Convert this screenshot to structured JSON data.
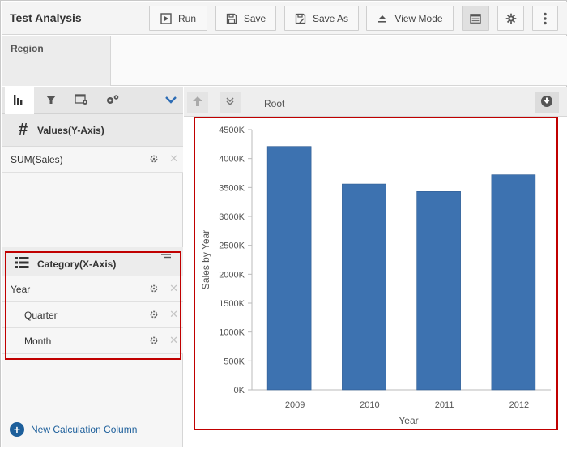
{
  "header": {
    "title": "Test Analysis",
    "buttons": [
      {
        "label": "Run",
        "icon": "play-icon"
      },
      {
        "label": "Save",
        "icon": "floppy-icon"
      },
      {
        "label": "Save As",
        "icon": "floppy-pencil-icon"
      },
      {
        "label": "View Mode",
        "icon": "eject-icon"
      }
    ]
  },
  "region": {
    "label": "Region"
  },
  "left_panel": {
    "values_title": "Values(Y-Axis)",
    "values_fields": [
      "SUM(Sales)"
    ],
    "category_title": "Category(X-Axis)",
    "category_fields": [
      "Year",
      "Quarter",
      "Month"
    ],
    "new_calc_label": "New Calculation Column"
  },
  "nav": {
    "root_label": "Root"
  },
  "chart_data": {
    "type": "bar",
    "categories": [
      "2009",
      "2010",
      "2011",
      "2012"
    ],
    "values": [
      4210000,
      3560000,
      3430000,
      3720000
    ],
    "xlabel": "Year",
    "ylabel": "Sales by Year",
    "ylim": [
      0,
      4500000
    ],
    "yticks": [
      "0K",
      "500K",
      "1000K",
      "1500K",
      "2000K",
      "2500K",
      "3000K",
      "3500K",
      "4000K",
      "4500K"
    ],
    "bar_color": "#3d72b0",
    "grid": false
  },
  "colors": {
    "highlight": "#c00000",
    "accent": "#1d5f9b"
  }
}
